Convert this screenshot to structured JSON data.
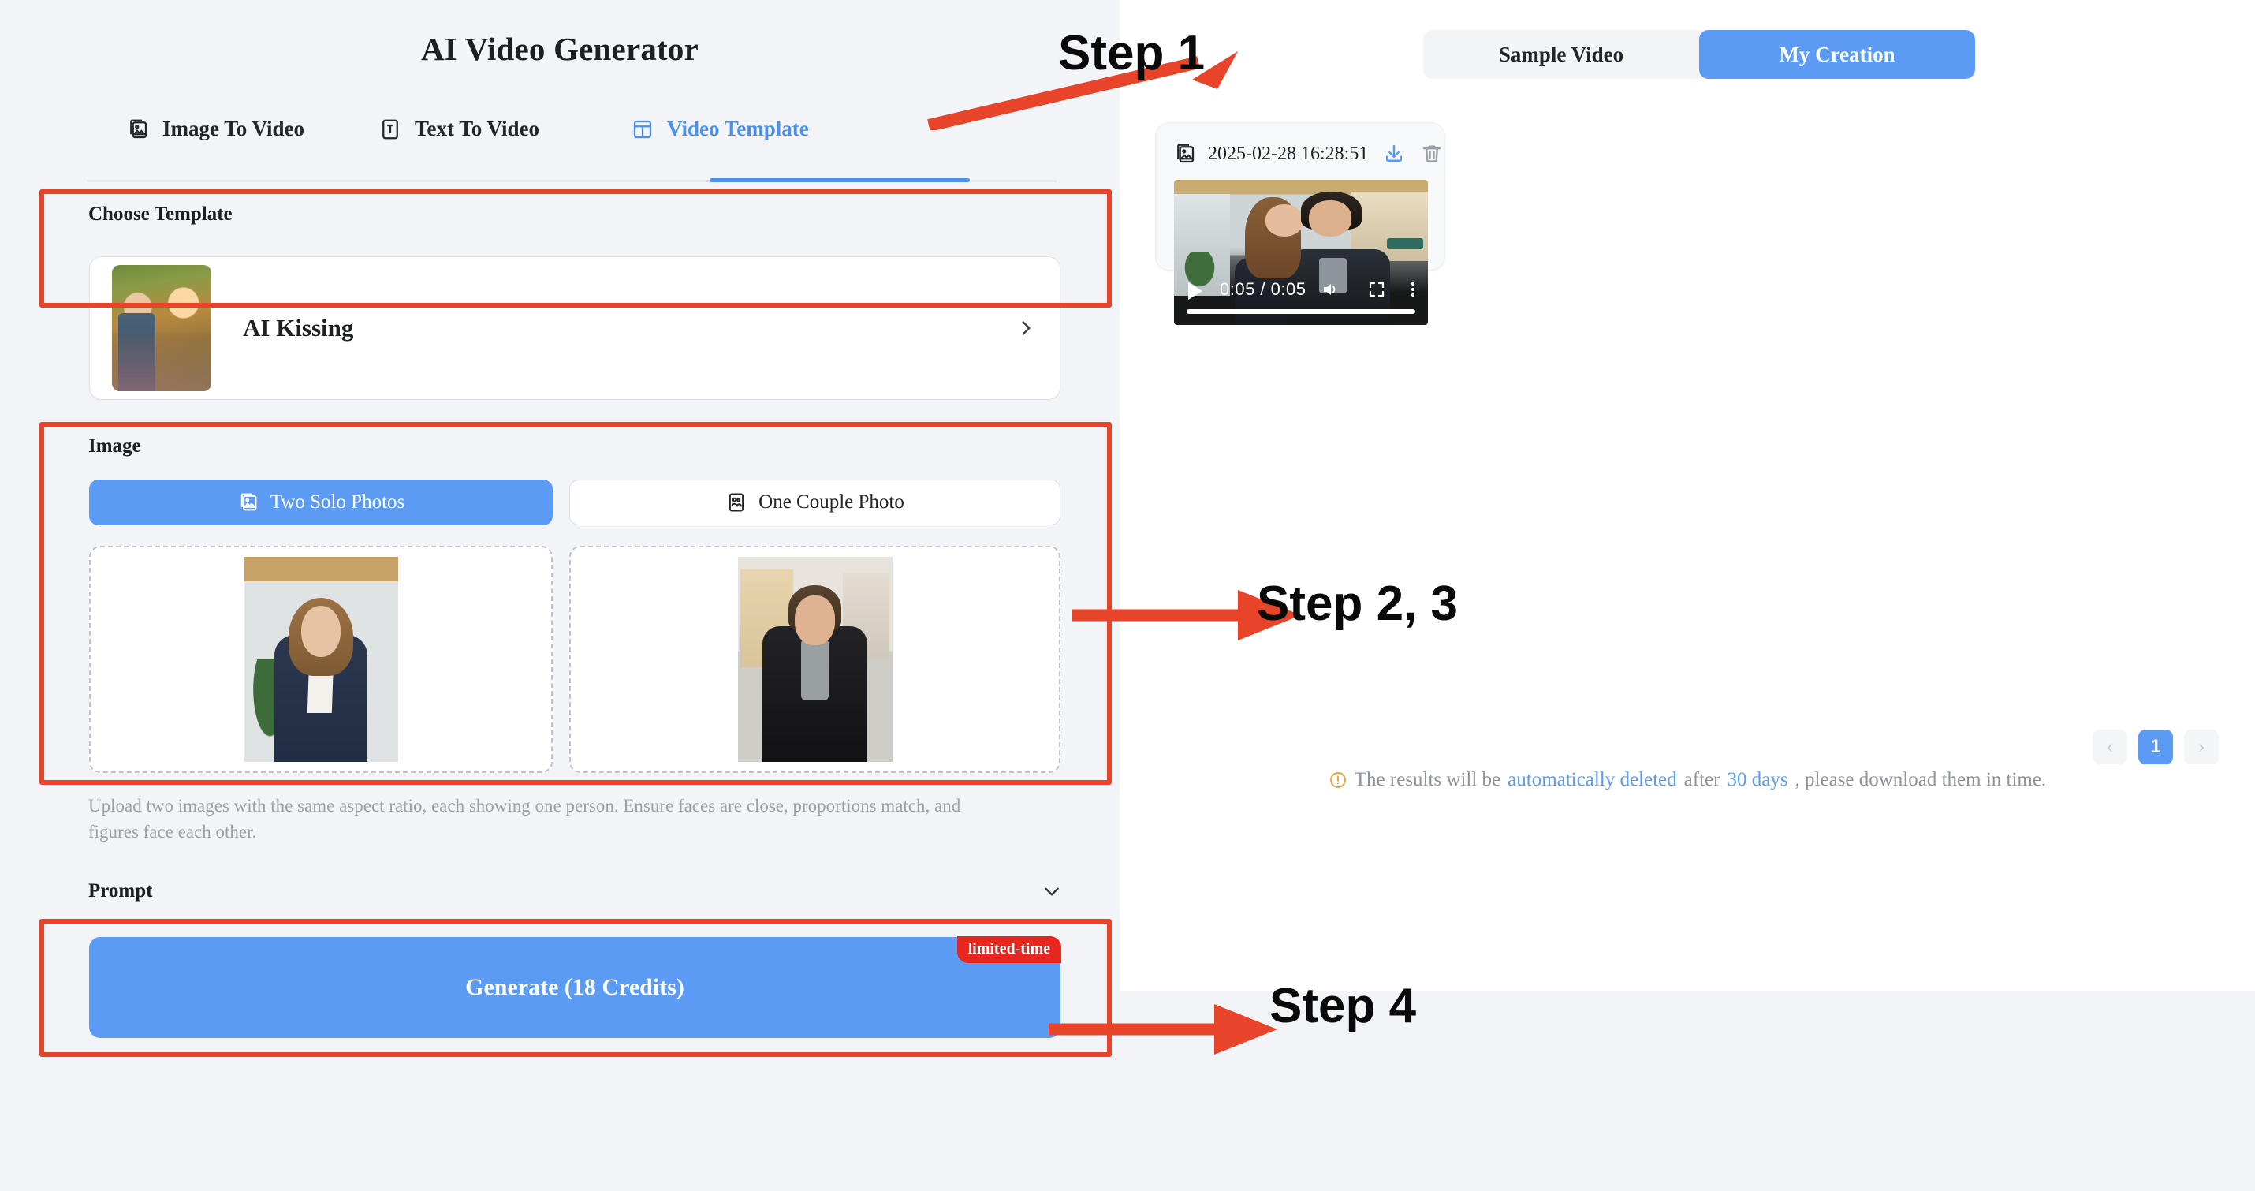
{
  "app": {
    "title": "AI Video Generator"
  },
  "tabs": [
    {
      "label": "Image To Video",
      "icon": "image-to-video-icon",
      "active": false
    },
    {
      "label": "Text To Video",
      "icon": "text-to-video-icon",
      "active": false
    },
    {
      "label": "Video Template",
      "icon": "video-template-icon",
      "active": true
    }
  ],
  "choose_template": {
    "label": "Choose Template",
    "selected": {
      "name": "AI Kissing",
      "thumbnail": "couple-thumbnail",
      "chevron": "chevron-right-icon"
    }
  },
  "image_section": {
    "label": "Image",
    "modes": [
      {
        "label": "Two Solo Photos",
        "icon": "two-photos-icon",
        "active": true
      },
      {
        "label": "One Couple Photo",
        "icon": "couple-photo-icon",
        "active": false
      }
    ],
    "uploads": [
      {
        "name": "upload-slot-left",
        "content": "woman-business-portrait"
      },
      {
        "name": "upload-slot-right",
        "content": "man-coat-portrait"
      }
    ],
    "hint": "Upload two images with the same aspect ratio, each showing one person. Ensure faces are close, proportions match, and figures face each other."
  },
  "prompt": {
    "label": "Prompt",
    "chevron": "chevron-down-icon",
    "expanded": false
  },
  "generate": {
    "label": "Generate (18 Credits)",
    "badge": "limited-time",
    "credits": 18
  },
  "right": {
    "tabs": [
      {
        "label": "Sample Video",
        "active": false
      },
      {
        "label": "My Creation",
        "active": true
      }
    ],
    "creation": {
      "timestamp": "2025-02-28 16:28:51",
      "type_icon": "image-video-icon",
      "download_icon": "download-icon",
      "delete_icon": "trash-icon",
      "player": {
        "play_icon": "play-icon",
        "time": "0:05 / 0:05",
        "current": "0:05",
        "duration": "0:05",
        "volume_icon": "volume-icon",
        "fullscreen_icon": "fullscreen-icon",
        "more_icon": "more-vertical-icon",
        "progress_percent": 100
      }
    },
    "pagination": {
      "prev": "‹",
      "pages": [
        "1"
      ],
      "current": "1",
      "next": "›"
    },
    "notice": {
      "icon": "warning-circle-icon",
      "part1": "The results will be ",
      "link1": "automatically deleted",
      "part2": " after ",
      "link2": "30 days",
      "part3": ", please download them in time."
    }
  },
  "annotations": [
    {
      "label": "Step 1",
      "arrow": "arrow-up-right"
    },
    {
      "label": "Step 2, 3",
      "arrow": "arrow-right"
    },
    {
      "label": "Step 4",
      "arrow": "arrow-right"
    }
  ],
  "colors": {
    "accent_blue": "#5b9bf3",
    "highlight_red": "#e8442a",
    "badge_red": "#e8261e",
    "page_bg": "#f2f4f7",
    "panel_bg": "#ffffff",
    "muted_text": "#9ba1a9"
  }
}
